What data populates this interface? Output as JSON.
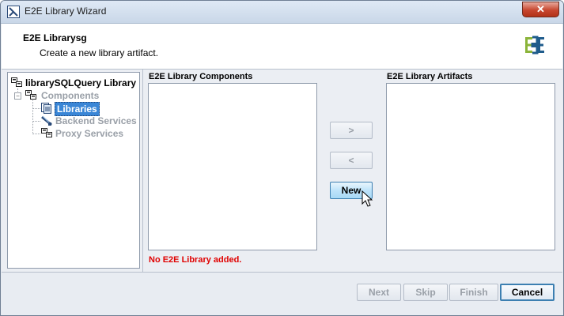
{
  "window": {
    "title": "E2E Library Wizard",
    "close_label": "✕"
  },
  "header": {
    "title": "E2E Librarysg",
    "subtitle": "Create a new library artifact."
  },
  "tree": {
    "root": "librarySQLQuery Library",
    "components": "Components",
    "libraries": "Libraries",
    "backend": "Backend Services",
    "proxy": "Proxy Services"
  },
  "components_panel": {
    "label": "E2E Library Components"
  },
  "artifacts_panel": {
    "label": "E2E Library Artifacts"
  },
  "transfer": {
    "add_label": ">",
    "remove_label": "<",
    "new_label": "New"
  },
  "status": {
    "message": "No E2E Library added."
  },
  "footer": {
    "next": "Next",
    "skip": "Skip",
    "finish": "Finish",
    "cancel": "Cancel"
  },
  "colors": {
    "error": "#e00000",
    "selection": "#3a86d6",
    "logo_green": "#8bb43a",
    "logo_blue": "#1f5c8c"
  }
}
